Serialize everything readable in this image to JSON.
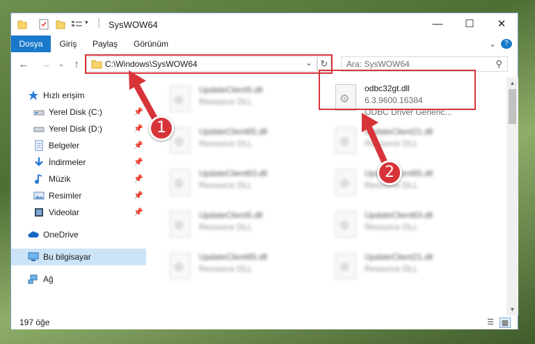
{
  "window": {
    "title": "SysWOW64"
  },
  "window_controls": {
    "minimize": "—",
    "maximize": "☐",
    "close": "✕"
  },
  "ribbon": {
    "tabs": [
      "Dosya",
      "Giriş",
      "Paylaş",
      "Görünüm"
    ],
    "help_icons": [
      "⌄",
      "?"
    ]
  },
  "address": {
    "path": "C:\\Windows\\SysWOW64",
    "dropdown": "⌄",
    "refresh": "↻"
  },
  "search": {
    "placeholder": "Ara: SysWOW64",
    "icon": "⚲"
  },
  "nav": {
    "back": "←",
    "forward": "→",
    "recent": "⌄",
    "up": "↑",
    "items": [
      {
        "label": "Hızlı erişim",
        "icon": "star-icon",
        "pinned": false
      },
      {
        "label": "Yerel Disk (C:)",
        "icon": "drive-icon",
        "pinned": true
      },
      {
        "label": "Yerel Disk (D:)",
        "icon": "drive-icon",
        "pinned": true
      },
      {
        "label": "Belgeler",
        "icon": "documents-icon",
        "pinned": true
      },
      {
        "label": "İndirmeler",
        "icon": "download-icon",
        "pinned": true
      },
      {
        "label": "Müzik",
        "icon": "music-icon",
        "pinned": true
      },
      {
        "label": "Resimler",
        "icon": "pictures-icon",
        "pinned": true
      },
      {
        "label": "Videolar",
        "icon": "videos-icon",
        "pinned": true
      },
      {
        "label": "OneDrive",
        "icon": "cloud-icon",
        "pinned": false
      },
      {
        "label": "Bu bilgisayar",
        "icon": "computer-icon",
        "pinned": false
      },
      {
        "label": "Ağ",
        "icon": "network-icon",
        "pinned": false
      }
    ],
    "pin_glyph": "📌"
  },
  "files": {
    "left": [
      {
        "name": "UpdateClient5.dll",
        "type": "Resource DLL"
      },
      {
        "name": "UpdateClient65.dll",
        "type": "Resource DLL"
      },
      {
        "name": "UpdateClient63.dll",
        "type": "Resource DLL"
      },
      {
        "name": "UpdateClient5.dll",
        "type": "Resource DLL"
      },
      {
        "name": "UpdateClient65.dll",
        "type": "Resource DLL"
      }
    ],
    "highlighted": {
      "name": "odbc32gt.dll",
      "version": "6.3.9600.16384",
      "desc": "ODBC Driver Generic..."
    },
    "right": [
      {
        "name": "UpdateClient21.dll",
        "type": "Resource DLL"
      },
      {
        "name": "UpdateClient65.dll",
        "type": "Resource DLL"
      },
      {
        "name": "UpdateClient63.dll",
        "type": "Resource DLL"
      },
      {
        "name": "UpdateClient21.dll",
        "type": "Resource DLL"
      }
    ]
  },
  "status": {
    "count": "197 öğe"
  },
  "callouts": [
    "1",
    "2"
  ],
  "colors": {
    "accent": "#1979ca",
    "highlight": "#d7343a",
    "selected": "#cce4f7"
  }
}
